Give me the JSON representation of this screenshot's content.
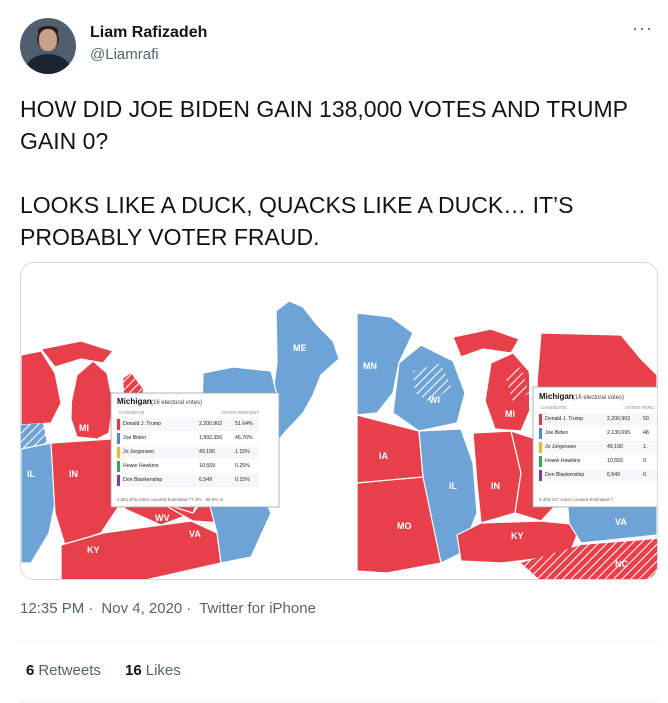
{
  "author": {
    "name": "Liam Rafizadeh",
    "handle": "@Liamrafi"
  },
  "tweet_text": "HOW DID JOE BIDEN GAIN 138,000 VOTES AND TRUMP GAIN 0?\n\nLOOKS LIKE A DUCK, QUACKS LIKE A DUCK… IT’S PROBABLY VOTER FRAUD.",
  "media": {
    "left_map": {
      "state_labels": [
        "ME",
        "MI",
        "IL",
        "IN",
        "WV",
        "VA",
        "KY"
      ],
      "box_title": "Michigan",
      "box_subtitle": "(16 electoral votes)",
      "col_candidate": "CANDIDATE",
      "col_votes": "VOTES PERCENT",
      "rows": [
        {
          "name": "Donald J. Trump",
          "votes": "2,200,902",
          "pct": "51.64%",
          "color": "#e0383e"
        },
        {
          "name": "Joe Biden",
          "votes": "1,992,356",
          "pct": "46.76%",
          "color": "#4a8ad0"
        },
        {
          "name": "Jo Jorgensen",
          "votes": "49,190",
          "pct": "1.15%",
          "color": "#e8b92c"
        },
        {
          "name": "Howie Hawkins",
          "votes": "10,559",
          "pct": "0.25%",
          "color": "#3aa35a"
        },
        {
          "name": "Don Blankenship",
          "votes": "6,549",
          "pct": "0.15%",
          "color": "#7a3fa0"
        }
      ],
      "footer": "4,261,878 votes counted  Estimated 77.3% - 90.9% in"
    },
    "right_map": {
      "state_labels": [
        "MN",
        "WI",
        "MI",
        "IA",
        "IL",
        "IN",
        "MO",
        "KY",
        "VA",
        "NC"
      ],
      "box_title": "Michigan",
      "box_subtitle": "(16 electoral votes)",
      "col_candidate": "CANDIDATE",
      "col_votes": "VOTES PERC",
      "rows": [
        {
          "name": "Donald J. Trump",
          "votes": "2,200,902",
          "pct": "50.",
          "color": "#e0383e"
        },
        {
          "name": "Joe Biden",
          "votes": "2,130,695",
          "pct": "48.",
          "color": "#4a8ad0"
        },
        {
          "name": "Jo Jorgensen",
          "votes": "49,190",
          "pct": "1.",
          "color": "#e8b92c"
        },
        {
          "name": "Howie Hawkins",
          "votes": "10,559",
          "pct": "0.",
          "color": "#3aa35a"
        },
        {
          "name": "Don Blankenship",
          "votes": "6,549",
          "pct": "0.",
          "color": "#7a3fa0"
        }
      ],
      "footer": "4,400,217 votes counted  Estimated 7"
    },
    "colors": {
      "red": "#e8404a",
      "blue": "#6ea3d6",
      "lake": "#ffffff"
    }
  },
  "meta": {
    "time": "12:35 PM",
    "sep1": "·",
    "date": "Nov 4, 2020",
    "sep2": "·",
    "source": "Twitter for iPhone"
  },
  "stats": {
    "retweets_count": "6",
    "retweets_label": "Retweets",
    "likes_count": "16",
    "likes_label": "Likes"
  }
}
